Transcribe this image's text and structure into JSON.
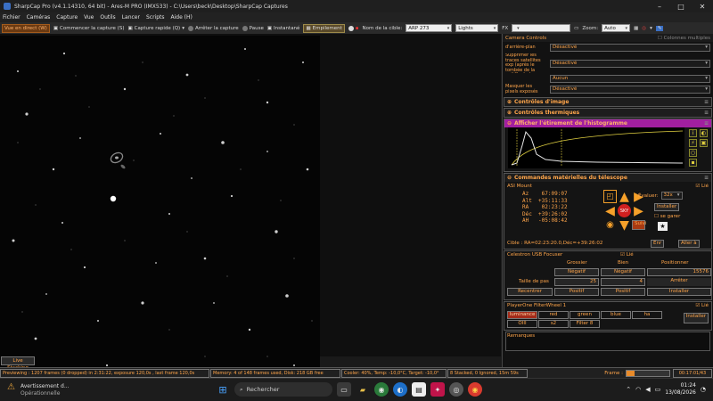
{
  "window": {
    "title": "SharpCap Pro (v4.1.14310, 64 bit) - Ares-M PRO (IMX533) - C:\\Users\\beck\\Desktop\\SharpCap Captures"
  },
  "menu": [
    "Fichier",
    "Caméras",
    "Capture",
    "Vue",
    "Outils",
    "Lancer",
    "Scripts",
    "Aide (H)"
  ],
  "toolbar": {
    "live_view": "Vue en direct (W)",
    "start_capture": "Commencer la capture (S)",
    "quick_capture": "Capture rapide (Q)",
    "stop_capture": "Arrêter la capture",
    "pause": "Pause",
    "snapshot": "Instantané",
    "stack": "Empilement",
    "target_label": "Nom de la cible:",
    "target_value": "ARP 273",
    "frame_type": "Lights",
    "fx_label": "FX",
    "zoom_label": "Zoom:",
    "zoom_value": "Auto"
  },
  "live_stacking": "Live Stacking",
  "status": {
    "preview": "Previewing : 1207 frames (0 dropped) in 2:31:22, exposure 120,0s , last frame 120,0s",
    "memory": "Memory: 4 of 148 frames used, Disk: 218 GB free",
    "cooler": "Cooler: 40%, Temp: -10,0°C, Target: -10,0°",
    "stacked": "8 Stacked, 0 Ignored, 15m 59s",
    "frame_label": "Frame :",
    "frame_time": "00:17:01/43",
    "frame_progress": 0.18
  },
  "panel": {
    "header": "Camera Controls",
    "header_check": "Colonnes multiples",
    "camera_rows": [
      {
        "label": "d'arrière-plan",
        "value": "Désactivé"
      },
      {
        "label": "Supprimer les traces satellites exp (après le tombée de la nuit/l'aube)",
        "value": "Désactivé"
      },
      {
        "label": "",
        "value": "Aucun"
      },
      {
        "label": "Masquer les pixels exposés",
        "value": "Désactivé"
      }
    ],
    "image_controls": "Contrôles d'image",
    "thermal_controls": "Contrôles thermiques",
    "histogram_stretch": "Afficher l'étirement de l'histogramme",
    "telescope_title": "Commandes matérielles du télescope",
    "mount": {
      "name": "ASI Mount",
      "linked": "Lié",
      "az": "Az    67:09:07",
      "alt": "Alt  +35:11:33",
      "ra": "RA    02:23:22",
      "dec": "Déc  +39:26:02",
      "ah": "AH   -05:08:42",
      "rate_label": "Évaluer:",
      "rate_value": "32x",
      "install": "Installer",
      "park": "se garer",
      "follow": "Suivi",
      "target": "Cible : RA=02:23:20.0,Déc=+39:26:02",
      "en": "Enr",
      "goto": "Aller à",
      "center_icon": "SKY"
    },
    "focuser": {
      "name": "Celestron USB Focuser",
      "linked": "Lié",
      "coarse": "Grossier",
      "fine": "Bien",
      "position": "Positionner",
      "negative": "Négatif",
      "position_value": "15576",
      "step_label": "Taille de pas",
      "coarse_step": "25",
      "fine_step": "4",
      "stop": "Arrêter",
      "recenter": "Recentrer",
      "positive": "Positif",
      "install": "Installer"
    },
    "filterwheel": {
      "name": "PlayerOne FilterWheel 1",
      "linked": "Lié",
      "row1": [
        "luminance",
        "red",
        "green",
        "blue",
        "ha"
      ],
      "row2": [
        "OIII",
        "s2",
        "Filter 8"
      ],
      "selected": "luminance",
      "install": "Installer"
    },
    "remarks": "Remarques"
  },
  "taskbar": {
    "warning_title": "Avertissement d...",
    "warning_sub": "Opérationnelle",
    "search": "Rechercher",
    "time": "01:24",
    "date": "13/08/2026"
  }
}
